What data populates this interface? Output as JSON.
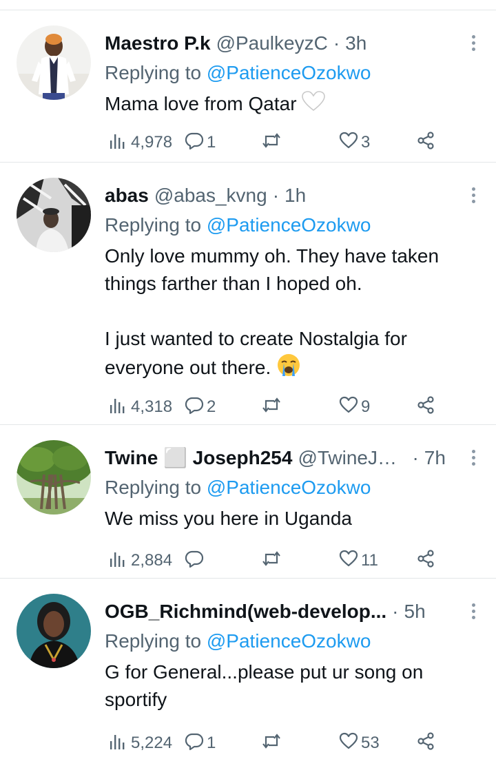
{
  "reply_prefix": "Replying to",
  "tweets": [
    {
      "name": "Maestro P.k",
      "handle": "@PaulkeyzC",
      "time": "3h",
      "mention": "@PatienceOzokwo",
      "body": "Mama love from Qatar",
      "emoji": "white-heart",
      "views": "4,978",
      "replies": "1",
      "retweets": "",
      "likes": "3"
    },
    {
      "name": "abas",
      "handle": "@abas_kvng",
      "time": "1h",
      "mention": "@PatienceOzokwo",
      "body": "Only love mummy oh. They have taken things farther than I hoped oh.\n\nI just wanted to create Nostalgia for everyone out there.",
      "emoji": "crying-face",
      "views": "4,318",
      "replies": "2",
      "retweets": "",
      "likes": "9"
    },
    {
      "name": "Twine ⬜ Joseph254",
      "handle": "@TwineJos...",
      "time": "7h",
      "mention": "@PatienceOzokwo",
      "body": "We miss you here in Uganda",
      "views": "2,884",
      "replies": "",
      "retweets": "",
      "likes": "11"
    },
    {
      "name": "OGB_Richmind(web-develop...",
      "handle": "",
      "time": "5h",
      "mention": "@PatienceOzokwo",
      "body": "G for General...please put ur song on sportify",
      "views": "5,224",
      "replies": "1",
      "retweets": "",
      "likes": "53"
    }
  ],
  "colors": {
    "text": "#0f1419",
    "muted": "#536471",
    "link": "#1d9bf0",
    "divider": "#e3e6e8"
  }
}
